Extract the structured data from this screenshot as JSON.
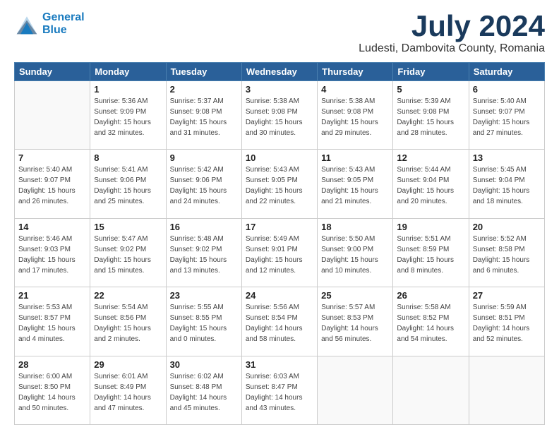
{
  "header": {
    "logo_line1": "General",
    "logo_line2": "Blue",
    "month": "July 2024",
    "location": "Ludesti, Dambovita County, Romania"
  },
  "weekdays": [
    "Sunday",
    "Monday",
    "Tuesday",
    "Wednesday",
    "Thursday",
    "Friday",
    "Saturday"
  ],
  "weeks": [
    [
      {
        "day": "",
        "info": ""
      },
      {
        "day": "1",
        "info": "Sunrise: 5:36 AM\nSunset: 9:09 PM\nDaylight: 15 hours\nand 32 minutes."
      },
      {
        "day": "2",
        "info": "Sunrise: 5:37 AM\nSunset: 9:08 PM\nDaylight: 15 hours\nand 31 minutes."
      },
      {
        "day": "3",
        "info": "Sunrise: 5:38 AM\nSunset: 9:08 PM\nDaylight: 15 hours\nand 30 minutes."
      },
      {
        "day": "4",
        "info": "Sunrise: 5:38 AM\nSunset: 9:08 PM\nDaylight: 15 hours\nand 29 minutes."
      },
      {
        "day": "5",
        "info": "Sunrise: 5:39 AM\nSunset: 9:08 PM\nDaylight: 15 hours\nand 28 minutes."
      },
      {
        "day": "6",
        "info": "Sunrise: 5:40 AM\nSunset: 9:07 PM\nDaylight: 15 hours\nand 27 minutes."
      }
    ],
    [
      {
        "day": "7",
        "info": "Sunrise: 5:40 AM\nSunset: 9:07 PM\nDaylight: 15 hours\nand 26 minutes."
      },
      {
        "day": "8",
        "info": "Sunrise: 5:41 AM\nSunset: 9:06 PM\nDaylight: 15 hours\nand 25 minutes."
      },
      {
        "day": "9",
        "info": "Sunrise: 5:42 AM\nSunset: 9:06 PM\nDaylight: 15 hours\nand 24 minutes."
      },
      {
        "day": "10",
        "info": "Sunrise: 5:43 AM\nSunset: 9:05 PM\nDaylight: 15 hours\nand 22 minutes."
      },
      {
        "day": "11",
        "info": "Sunrise: 5:43 AM\nSunset: 9:05 PM\nDaylight: 15 hours\nand 21 minutes."
      },
      {
        "day": "12",
        "info": "Sunrise: 5:44 AM\nSunset: 9:04 PM\nDaylight: 15 hours\nand 20 minutes."
      },
      {
        "day": "13",
        "info": "Sunrise: 5:45 AM\nSunset: 9:04 PM\nDaylight: 15 hours\nand 18 minutes."
      }
    ],
    [
      {
        "day": "14",
        "info": "Sunrise: 5:46 AM\nSunset: 9:03 PM\nDaylight: 15 hours\nand 17 minutes."
      },
      {
        "day": "15",
        "info": "Sunrise: 5:47 AM\nSunset: 9:02 PM\nDaylight: 15 hours\nand 15 minutes."
      },
      {
        "day": "16",
        "info": "Sunrise: 5:48 AM\nSunset: 9:02 PM\nDaylight: 15 hours\nand 13 minutes."
      },
      {
        "day": "17",
        "info": "Sunrise: 5:49 AM\nSunset: 9:01 PM\nDaylight: 15 hours\nand 12 minutes."
      },
      {
        "day": "18",
        "info": "Sunrise: 5:50 AM\nSunset: 9:00 PM\nDaylight: 15 hours\nand 10 minutes."
      },
      {
        "day": "19",
        "info": "Sunrise: 5:51 AM\nSunset: 8:59 PM\nDaylight: 15 hours\nand 8 minutes."
      },
      {
        "day": "20",
        "info": "Sunrise: 5:52 AM\nSunset: 8:58 PM\nDaylight: 15 hours\nand 6 minutes."
      }
    ],
    [
      {
        "day": "21",
        "info": "Sunrise: 5:53 AM\nSunset: 8:57 PM\nDaylight: 15 hours\nand 4 minutes."
      },
      {
        "day": "22",
        "info": "Sunrise: 5:54 AM\nSunset: 8:56 PM\nDaylight: 15 hours\nand 2 minutes."
      },
      {
        "day": "23",
        "info": "Sunrise: 5:55 AM\nSunset: 8:55 PM\nDaylight: 15 hours\nand 0 minutes."
      },
      {
        "day": "24",
        "info": "Sunrise: 5:56 AM\nSunset: 8:54 PM\nDaylight: 14 hours\nand 58 minutes."
      },
      {
        "day": "25",
        "info": "Sunrise: 5:57 AM\nSunset: 8:53 PM\nDaylight: 14 hours\nand 56 minutes."
      },
      {
        "day": "26",
        "info": "Sunrise: 5:58 AM\nSunset: 8:52 PM\nDaylight: 14 hours\nand 54 minutes."
      },
      {
        "day": "27",
        "info": "Sunrise: 5:59 AM\nSunset: 8:51 PM\nDaylight: 14 hours\nand 52 minutes."
      }
    ],
    [
      {
        "day": "28",
        "info": "Sunrise: 6:00 AM\nSunset: 8:50 PM\nDaylight: 14 hours\nand 50 minutes."
      },
      {
        "day": "29",
        "info": "Sunrise: 6:01 AM\nSunset: 8:49 PM\nDaylight: 14 hours\nand 47 minutes."
      },
      {
        "day": "30",
        "info": "Sunrise: 6:02 AM\nSunset: 8:48 PM\nDaylight: 14 hours\nand 45 minutes."
      },
      {
        "day": "31",
        "info": "Sunrise: 6:03 AM\nSunset: 8:47 PM\nDaylight: 14 hours\nand 43 minutes."
      },
      {
        "day": "",
        "info": ""
      },
      {
        "day": "",
        "info": ""
      },
      {
        "day": "",
        "info": ""
      }
    ]
  ]
}
